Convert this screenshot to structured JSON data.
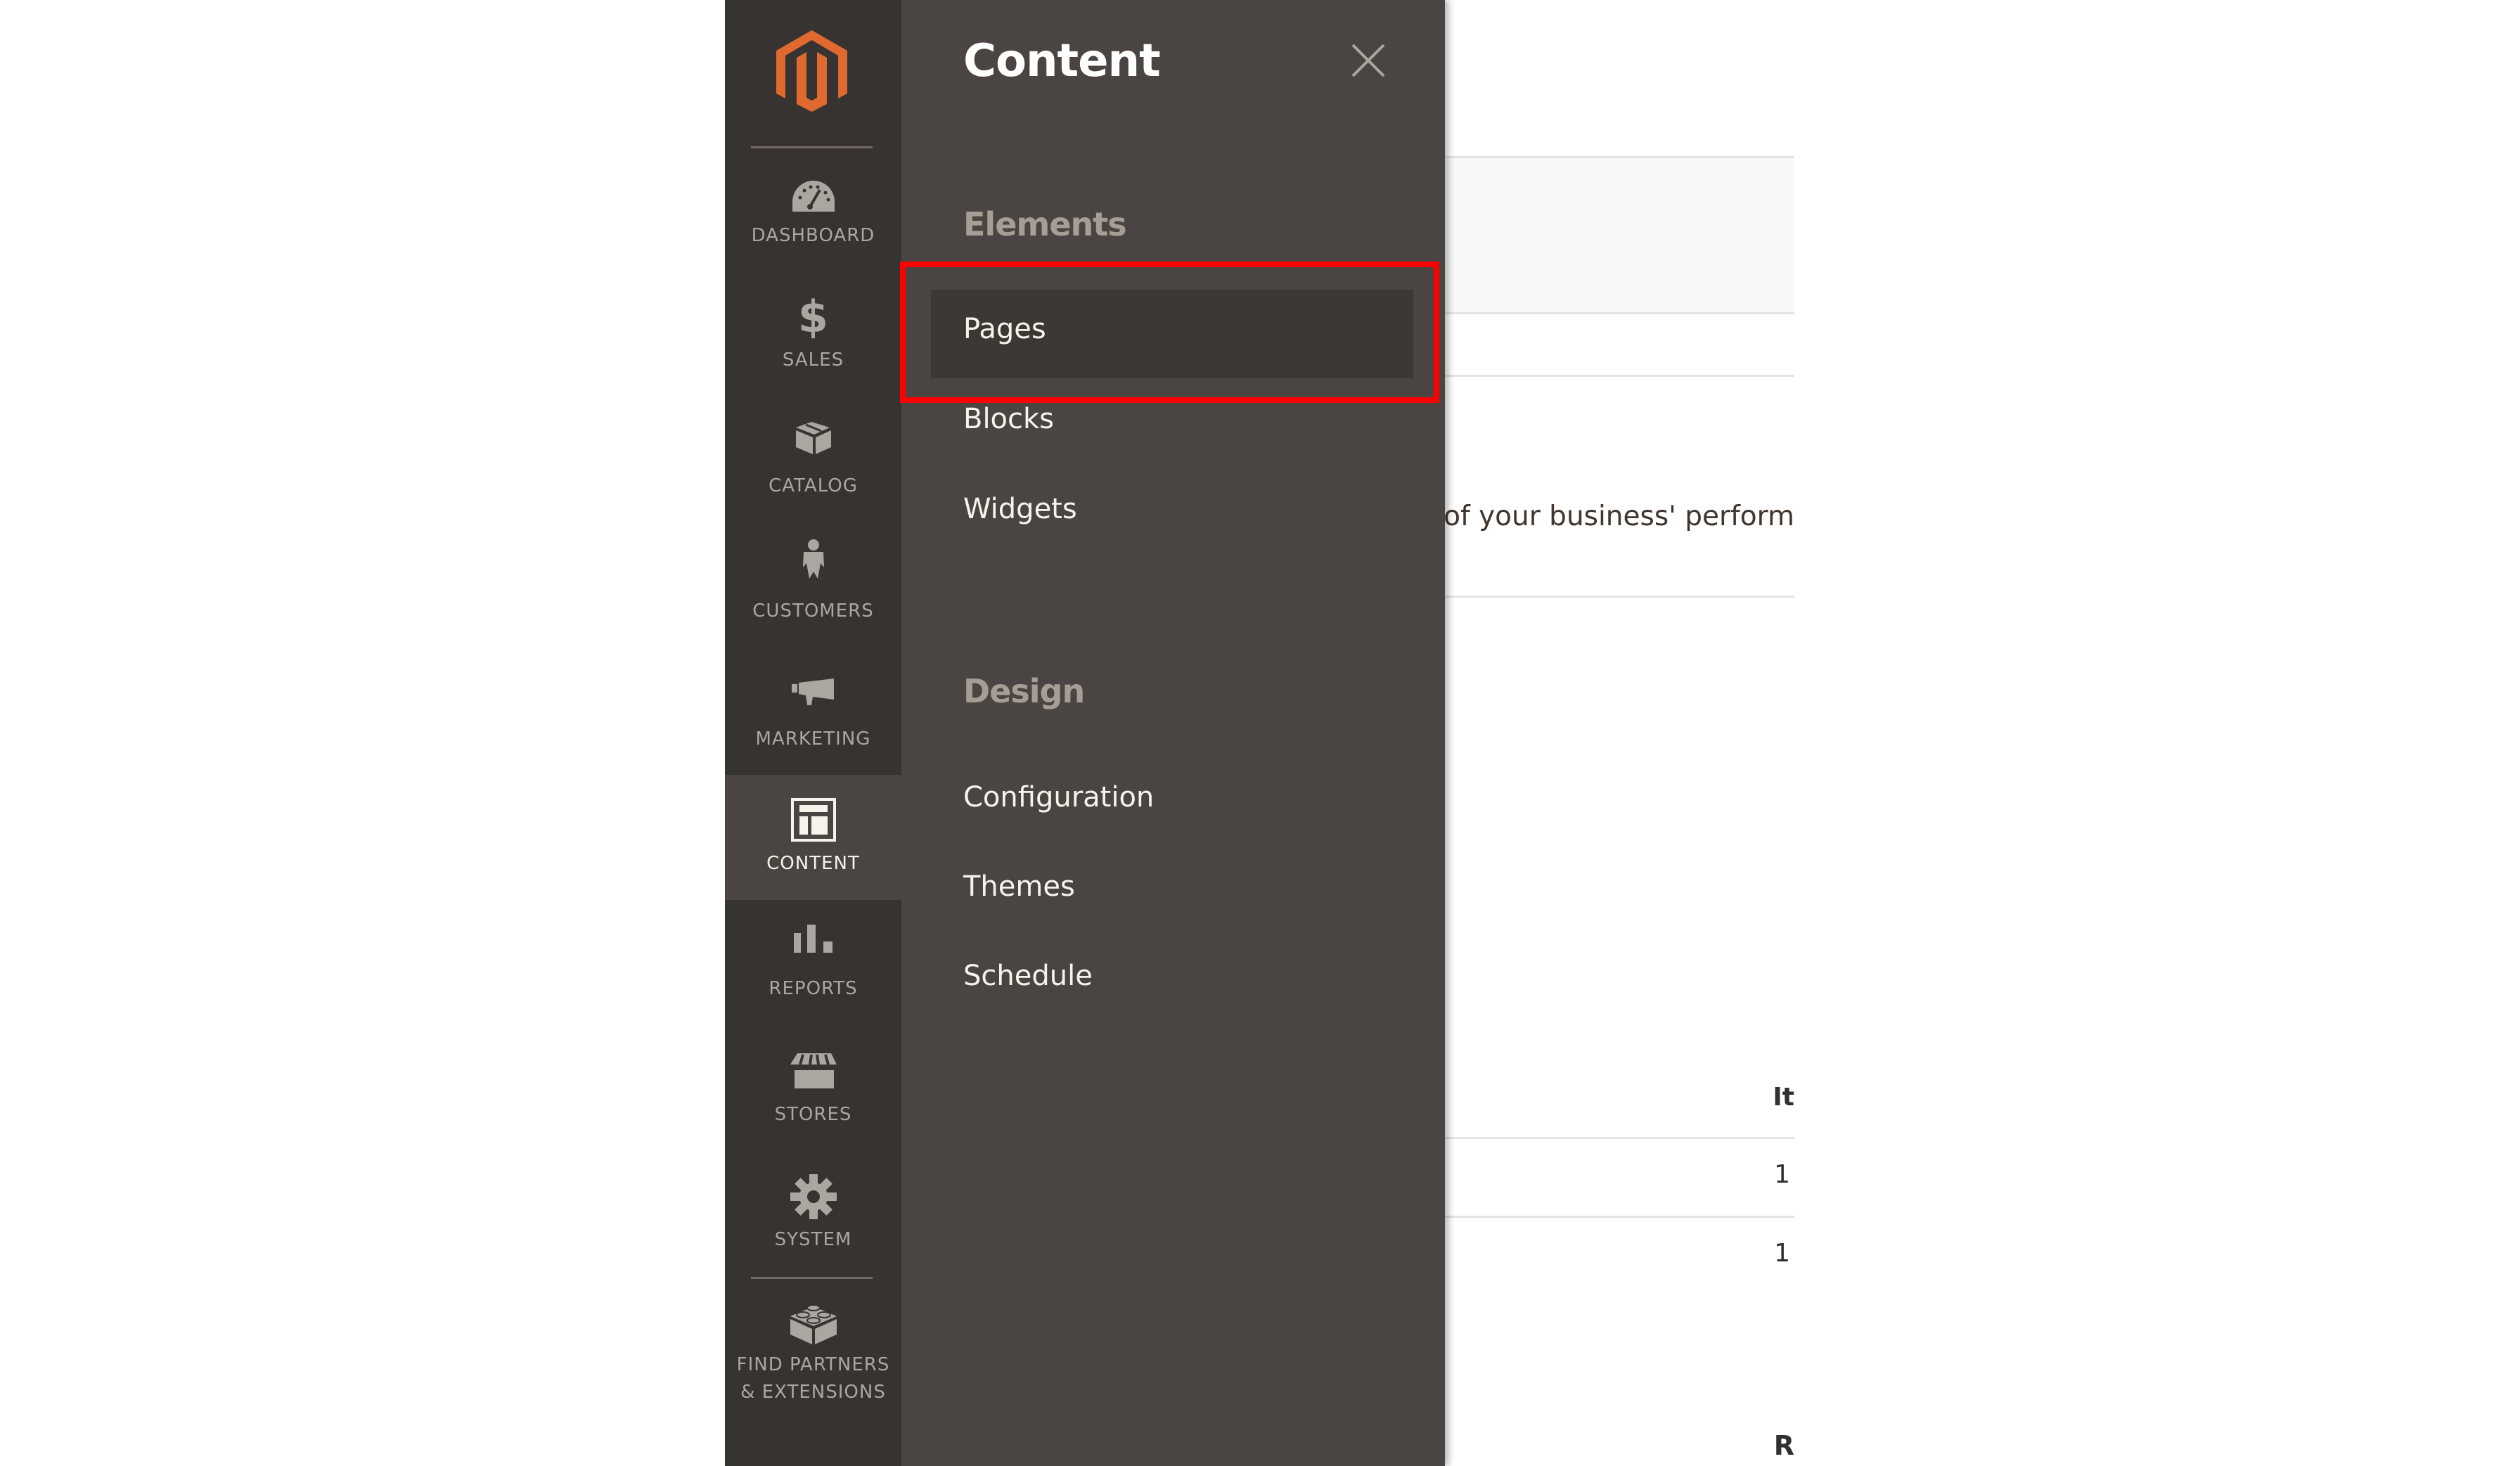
{
  "sidebar": {
    "logo": "magento-logo",
    "items": [
      {
        "label": "DASHBOARD",
        "icon": "dashboard-gauge-icon",
        "active": false
      },
      {
        "label": "SALES",
        "icon": "dollar-icon",
        "active": false
      },
      {
        "label": "CATALOG",
        "icon": "box-icon",
        "active": false
      },
      {
        "label": "CUSTOMERS",
        "icon": "person-icon",
        "active": false
      },
      {
        "label": "MARKETING",
        "icon": "megaphone-icon",
        "active": false
      },
      {
        "label": "CONTENT",
        "icon": "layout-icon",
        "active": true
      },
      {
        "label": "REPORTS",
        "icon": "bar-chart-icon",
        "active": false
      },
      {
        "label": "STORES",
        "icon": "storefront-icon",
        "active": false
      },
      {
        "label": "SYSTEM",
        "icon": "gear-icon",
        "active": false
      }
    ],
    "extensions": {
      "line1": "FIND PARTNERS",
      "line2": "& EXTENSIONS",
      "icon": "lego-brick-icon"
    }
  },
  "submenu": {
    "title": "Content",
    "close_icon": "close-icon",
    "groups": [
      {
        "title": "Elements",
        "items": [
          "Pages",
          "Blocks",
          "Widgets"
        ]
      },
      {
        "title": "Design",
        "items": [
          "Configuration",
          "Themes",
          "Schedule"
        ]
      }
    ],
    "highlighted_item": "Pages"
  },
  "background_page": {
    "description_fragment": "d of your business' perform",
    "table_header_fragment": "It",
    "table_cells": [
      "1",
      "1"
    ],
    "section_heading_fragment": "R"
  },
  "colors": {
    "sidebar_bg": "#373330",
    "submenu_bg": "#4a4542",
    "accent_logo": "#e0692f",
    "highlight_border": "#ff0000"
  }
}
